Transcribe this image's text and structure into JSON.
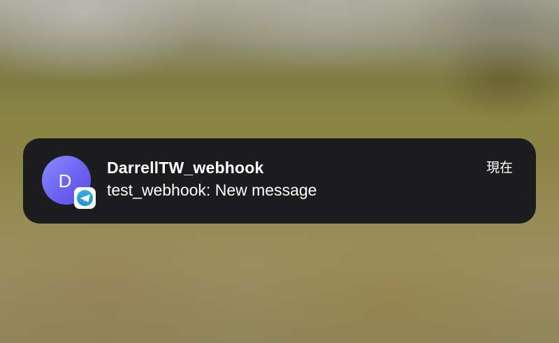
{
  "notification": {
    "avatar_letter": "D",
    "app_badge_icon": "telegram-icon",
    "title": "DarrellTW_webhook",
    "message": "test_webhook: New message",
    "time": "現在"
  },
  "colors": {
    "card_background": "#1c1c1e",
    "avatar_gradient_start": "#8a8dff",
    "avatar_gradient_end": "#5a4fe0",
    "telegram_blue": "#2aa3d9",
    "text": "#ffffff"
  }
}
